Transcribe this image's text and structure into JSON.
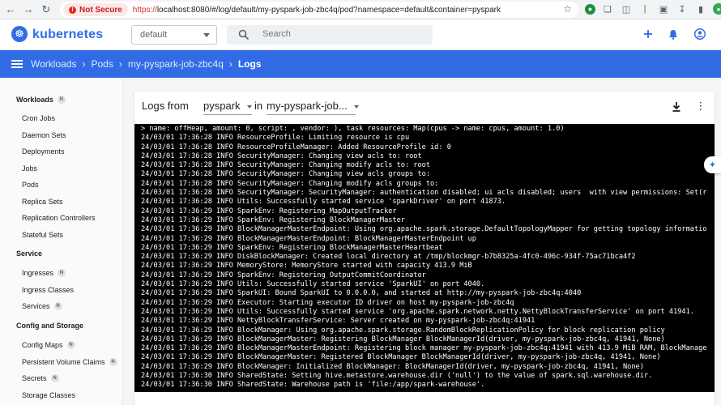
{
  "browser": {
    "security_label": "Not Secure",
    "url_scheme": "https://",
    "url_rest": "localhost:8080/#/log/default/my-pyspark-job-zbc4q/pod?namespace=default&container=pyspark"
  },
  "header": {
    "brand": "kubernetes",
    "namespace": "default",
    "search_placeholder": "Search"
  },
  "breadcrumb": {
    "items": [
      "Workloads",
      "Pods",
      "my-pyspark-job-zbc4q"
    ],
    "current": "Logs"
  },
  "sidebar": {
    "workloads_title": "Workloads",
    "workloads_badge": "N",
    "workloads": [
      "Cron Jobs",
      "Daemon Sets",
      "Deployments",
      "Jobs",
      "Pods",
      "Replica Sets",
      "Replication Controllers",
      "Stateful Sets"
    ],
    "service_title": "Service",
    "service": [
      {
        "label": "Ingresses",
        "badge": "N"
      },
      {
        "label": "Ingress Classes",
        "badge": ""
      },
      {
        "label": "Services",
        "badge": "N"
      }
    ],
    "config_title": "Config and Storage",
    "config": [
      {
        "label": "Config Maps",
        "badge": "N"
      },
      {
        "label": "Persistent Volume Claims",
        "badge": "N"
      },
      {
        "label": "Secrets",
        "badge": "N"
      },
      {
        "label": "Storage Classes",
        "badge": ""
      }
    ]
  },
  "logs": {
    "title": "Logs from",
    "container": "pyspark",
    "in_label": "in",
    "pod": "my-pyspark-job...",
    "lines": [
      "> name: offHeap, amount: 0, script: , vendor: ), task resources: Map(cpus -> name: cpus, amount: 1.0)",
      "24/03/01 17:36:28 INFO ResourceProfile: Limiting resource is cpu",
      "24/03/01 17:36:28 INFO ResourceProfileManager: Added ResourceProfile id: 0",
      "24/03/01 17:36:28 INFO SecurityManager: Changing view acls to: root",
      "24/03/01 17:36:28 INFO SecurityManager: Changing modify acls to: root",
      "24/03/01 17:36:28 INFO SecurityManager: Changing view acls groups to:",
      "24/03/01 17:36:28 INFO SecurityManager: Changing modify acls groups to:",
      "24/03/01 17:36:28 INFO SecurityManager: SecurityManager: authentication disabled; ui acls disabled; users  with view permissions: Set(r",
      "24/03/01 17:36:28 INFO Utils: Successfully started service 'sparkDriver' on port 41873.",
      "24/03/01 17:36:29 INFO SparkEnv: Registering MapOutputTracker",
      "24/03/01 17:36:29 INFO SparkEnv: Registering BlockManagerMaster",
      "24/03/01 17:36:29 INFO BlockManagerMasterEndpoint: Using org.apache.spark.storage.DefaultTopologyMapper for getting topology informatio",
      "24/03/01 17:36:29 INFO BlockManagerMasterEndpoint: BlockManagerMasterEndpoint up",
      "24/03/01 17:36:29 INFO SparkEnv: Registering BlockManagerMasterHeartbeat",
      "24/03/01 17:36:29 INFO DiskBlockManager: Created local directory at /tmp/blockmgr-b7b8325a-4fc0-496c-934f-75ac71bca4f2",
      "24/03/01 17:36:29 INFO MemoryStore: MemoryStore started with capacity 413.9 MiB",
      "24/03/01 17:36:29 INFO SparkEnv: Registering OutputCommitCoordinator",
      "24/03/01 17:36:29 INFO Utils: Successfully started service 'SparkUI' on port 4040.",
      "24/03/01 17:36:29 INFO SparkUI: Bound SparkUI to 0.0.0.0, and started at http://my-pyspark-job-zbc4q:4040",
      "24/03/01 17:36:29 INFO Executor: Starting executor ID driver on host my-pyspark-job-zbc4q",
      "24/03/01 17:36:29 INFO Utils: Successfully started service 'org.apache.spark.network.netty.NettyBlockTransferService' on port 41941.",
      "24/03/01 17:36:29 INFO NettyBlockTransferService: Server created on my-pyspark-job-zbc4q:41941",
      "24/03/01 17:36:29 INFO BlockManager: Using org.apache.spark.storage.RandomBlockReplicationPolicy for block replication policy",
      "24/03/01 17:36:29 INFO BlockManagerMaster: Registering BlockManager BlockManagerId(driver, my-pyspark-job-zbc4q, 41941, None)",
      "24/03/01 17:36:29 INFO BlockManagerMasterEndpoint: Registering block manager my-pyspark-job-zbc4q:41941 with 413.9 MiB RAM, BlockManage",
      "24/03/01 17:36:29 INFO BlockManagerMaster: Registered BlockManager BlockManagerId(driver, my-pyspark-job-zbc4q, 41941, None)",
      "24/03/01 17:36:29 INFO BlockManager: Initialized BlockManager: BlockManagerId(driver, my-pyspark-job-zbc4q, 41941, None)",
      "24/03/01 17:36:30 INFO SharedState: Setting hive.metastore.warehouse.dir ('null') to the value of spark.sql.warehouse.dir.",
      "24/03/01 17:36:30 INFO SharedState: Warehouse path is 'file:/app/spark-warehouse'."
    ]
  },
  "colors": {
    "brand_blue": "#326ce5",
    "console_bg": "#000000",
    "not_secure_red": "#d93025"
  }
}
